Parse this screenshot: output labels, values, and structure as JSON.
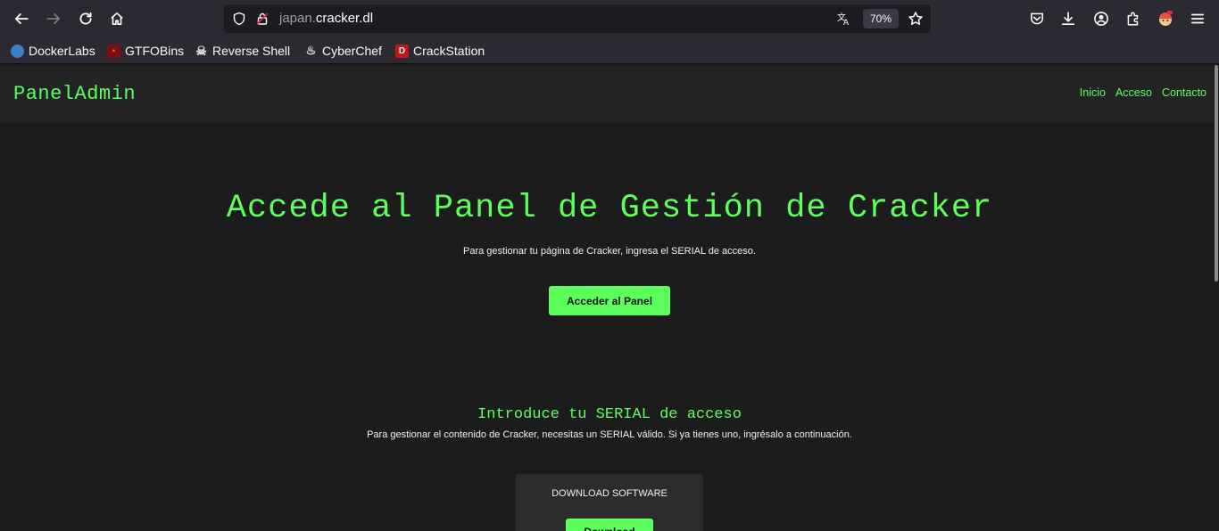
{
  "browser": {
    "url_subdomain": "japan.",
    "url_domain": "cracker.dl",
    "zoom": "70%",
    "icons": [
      "back-icon",
      "forward-icon",
      "reload-icon",
      "home-icon",
      "shield-icon",
      "lock-icon",
      "translate-icon",
      "star-icon",
      "pocket-icon",
      "download-icon",
      "account-icon",
      "extensions-icon",
      "profile-icon",
      "menu-icon"
    ]
  },
  "bookmarks": [
    {
      "label": "DockerLabs",
      "icon": "dockerlabs-icon"
    },
    {
      "label": "GTFOBins",
      "icon": "gtfobins-icon"
    },
    {
      "label": "Reverse Shell",
      "icon": "skull-icon"
    },
    {
      "label": "CyberChef",
      "icon": "chef-icon"
    },
    {
      "label": "CrackStation",
      "icon": "crackstation-icon"
    }
  ],
  "nav": {
    "brand": "PanelAdmin",
    "links": [
      "Inicio",
      "Acceso",
      "Contacto"
    ]
  },
  "hero": {
    "title": "Accede al Panel de Gestión de Cracker",
    "subtitle": "Para gestionar tu página de Cracker, ingresa el SERIAL de acceso.",
    "button": "Acceder al Panel"
  },
  "serial": {
    "title": "Introduce tu SERIAL de acceso",
    "description": "Para gestionar el contenido de Cracker, necesitas un SERIAL válido. Si ya tienes uno, ingrésalo a continuación."
  },
  "download": {
    "label": "DOWNLOAD SOFTWARE",
    "button": "Download"
  },
  "colors": {
    "accent": "#5cff5c",
    "page_bg": "#1c1c1c",
    "nav_bg": "#232323",
    "chrome_bg": "#2b2a33"
  }
}
